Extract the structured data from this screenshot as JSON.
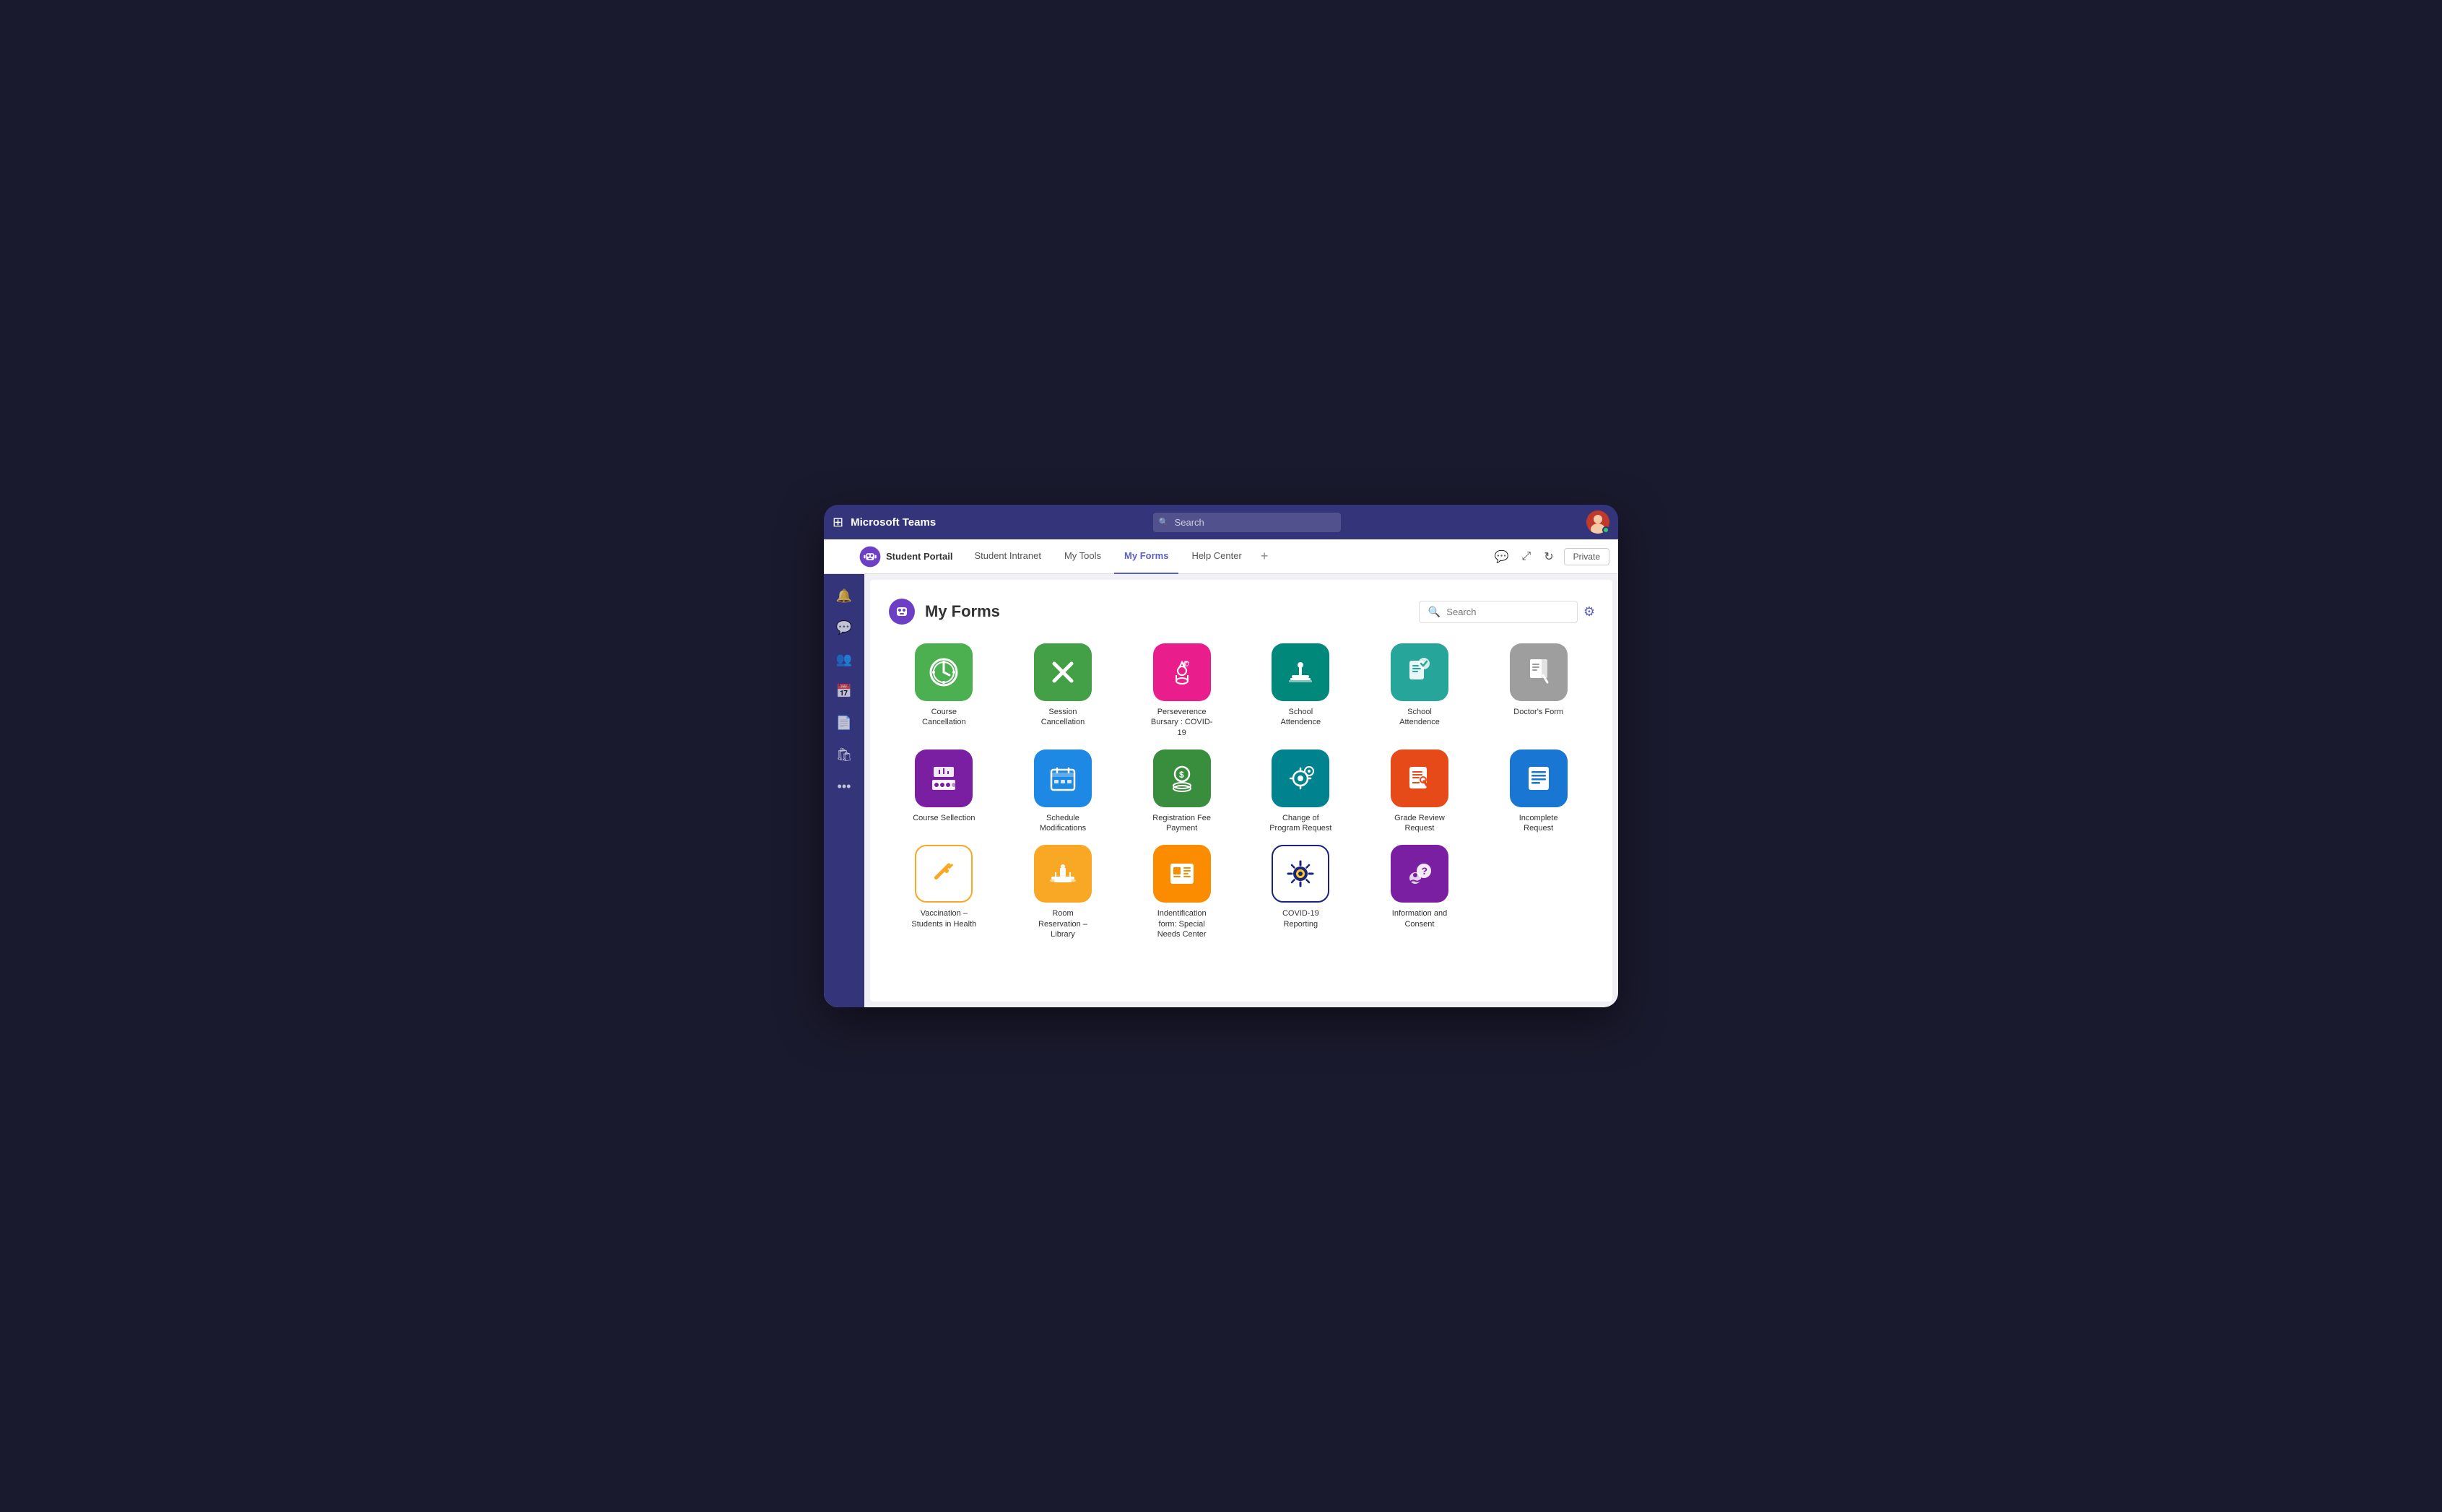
{
  "teams": {
    "title": "Microsoft Teams",
    "search_placeholder": "Search",
    "avatar_letter": "👤"
  },
  "tabs": {
    "app_name": "Student Portail",
    "items": [
      {
        "label": "Student Intranet",
        "active": false
      },
      {
        "label": "My Tools",
        "active": false
      },
      {
        "label": "My Forms",
        "active": true
      },
      {
        "label": "Help Center",
        "active": false
      }
    ],
    "plus_label": "+",
    "private_label": "Private"
  },
  "page": {
    "title": "My Forms",
    "search_placeholder": "Search"
  },
  "forms": [
    {
      "label": "Course Cancellation",
      "color": "bg-green",
      "icon": "⏱"
    },
    {
      "label": "Session Cancellation",
      "color": "bg-green2",
      "icon": "✕"
    },
    {
      "label": "Perseverence Bursary : COVID-19",
      "color": "bg-pink",
      "icon": "🏆"
    },
    {
      "label": "School Attendence",
      "color": "bg-teal",
      "icon": "🪑"
    },
    {
      "label": "School Attendence",
      "color": "bg-teal2",
      "icon": "📋"
    },
    {
      "label": "Doctor's Form",
      "color": "bg-gray",
      "icon": "📝"
    },
    {
      "label": "Course Sellection",
      "color": "bg-purple",
      "icon": "📊"
    },
    {
      "label": "Schedule Modifications",
      "color": "bg-blue",
      "icon": "📅"
    },
    {
      "label": "Registration Fee Payment",
      "color": "bg-green3",
      "icon": "💰"
    },
    {
      "label": "Change of Program Request",
      "color": "bg-teal3",
      "icon": "⚙"
    },
    {
      "label": "Grade Review Request",
      "color": "bg-orange",
      "icon": "📋"
    },
    {
      "label": "Incomplete Request",
      "color": "bg-blue2",
      "icon": "📄"
    },
    {
      "label": "Vaccination – Students in Health",
      "color": "bg-yellow-outline",
      "icon": "💉"
    },
    {
      "label": "Room Reservation – Library",
      "color": "bg-yellow",
      "icon": "🪑"
    },
    {
      "label": "Indentification form: Special Needs Center",
      "color": "bg-orange2",
      "icon": "📋"
    },
    {
      "label": "COVID-19 Reporting",
      "color": "bg-darkblue",
      "icon": "🦠"
    },
    {
      "label": "Information and Consent",
      "color": "bg-purple2",
      "icon": "❓"
    }
  ],
  "sidebar_icons": [
    "🔔",
    "💬",
    "👥",
    "📅",
    "📄",
    "🛍",
    "..."
  ]
}
